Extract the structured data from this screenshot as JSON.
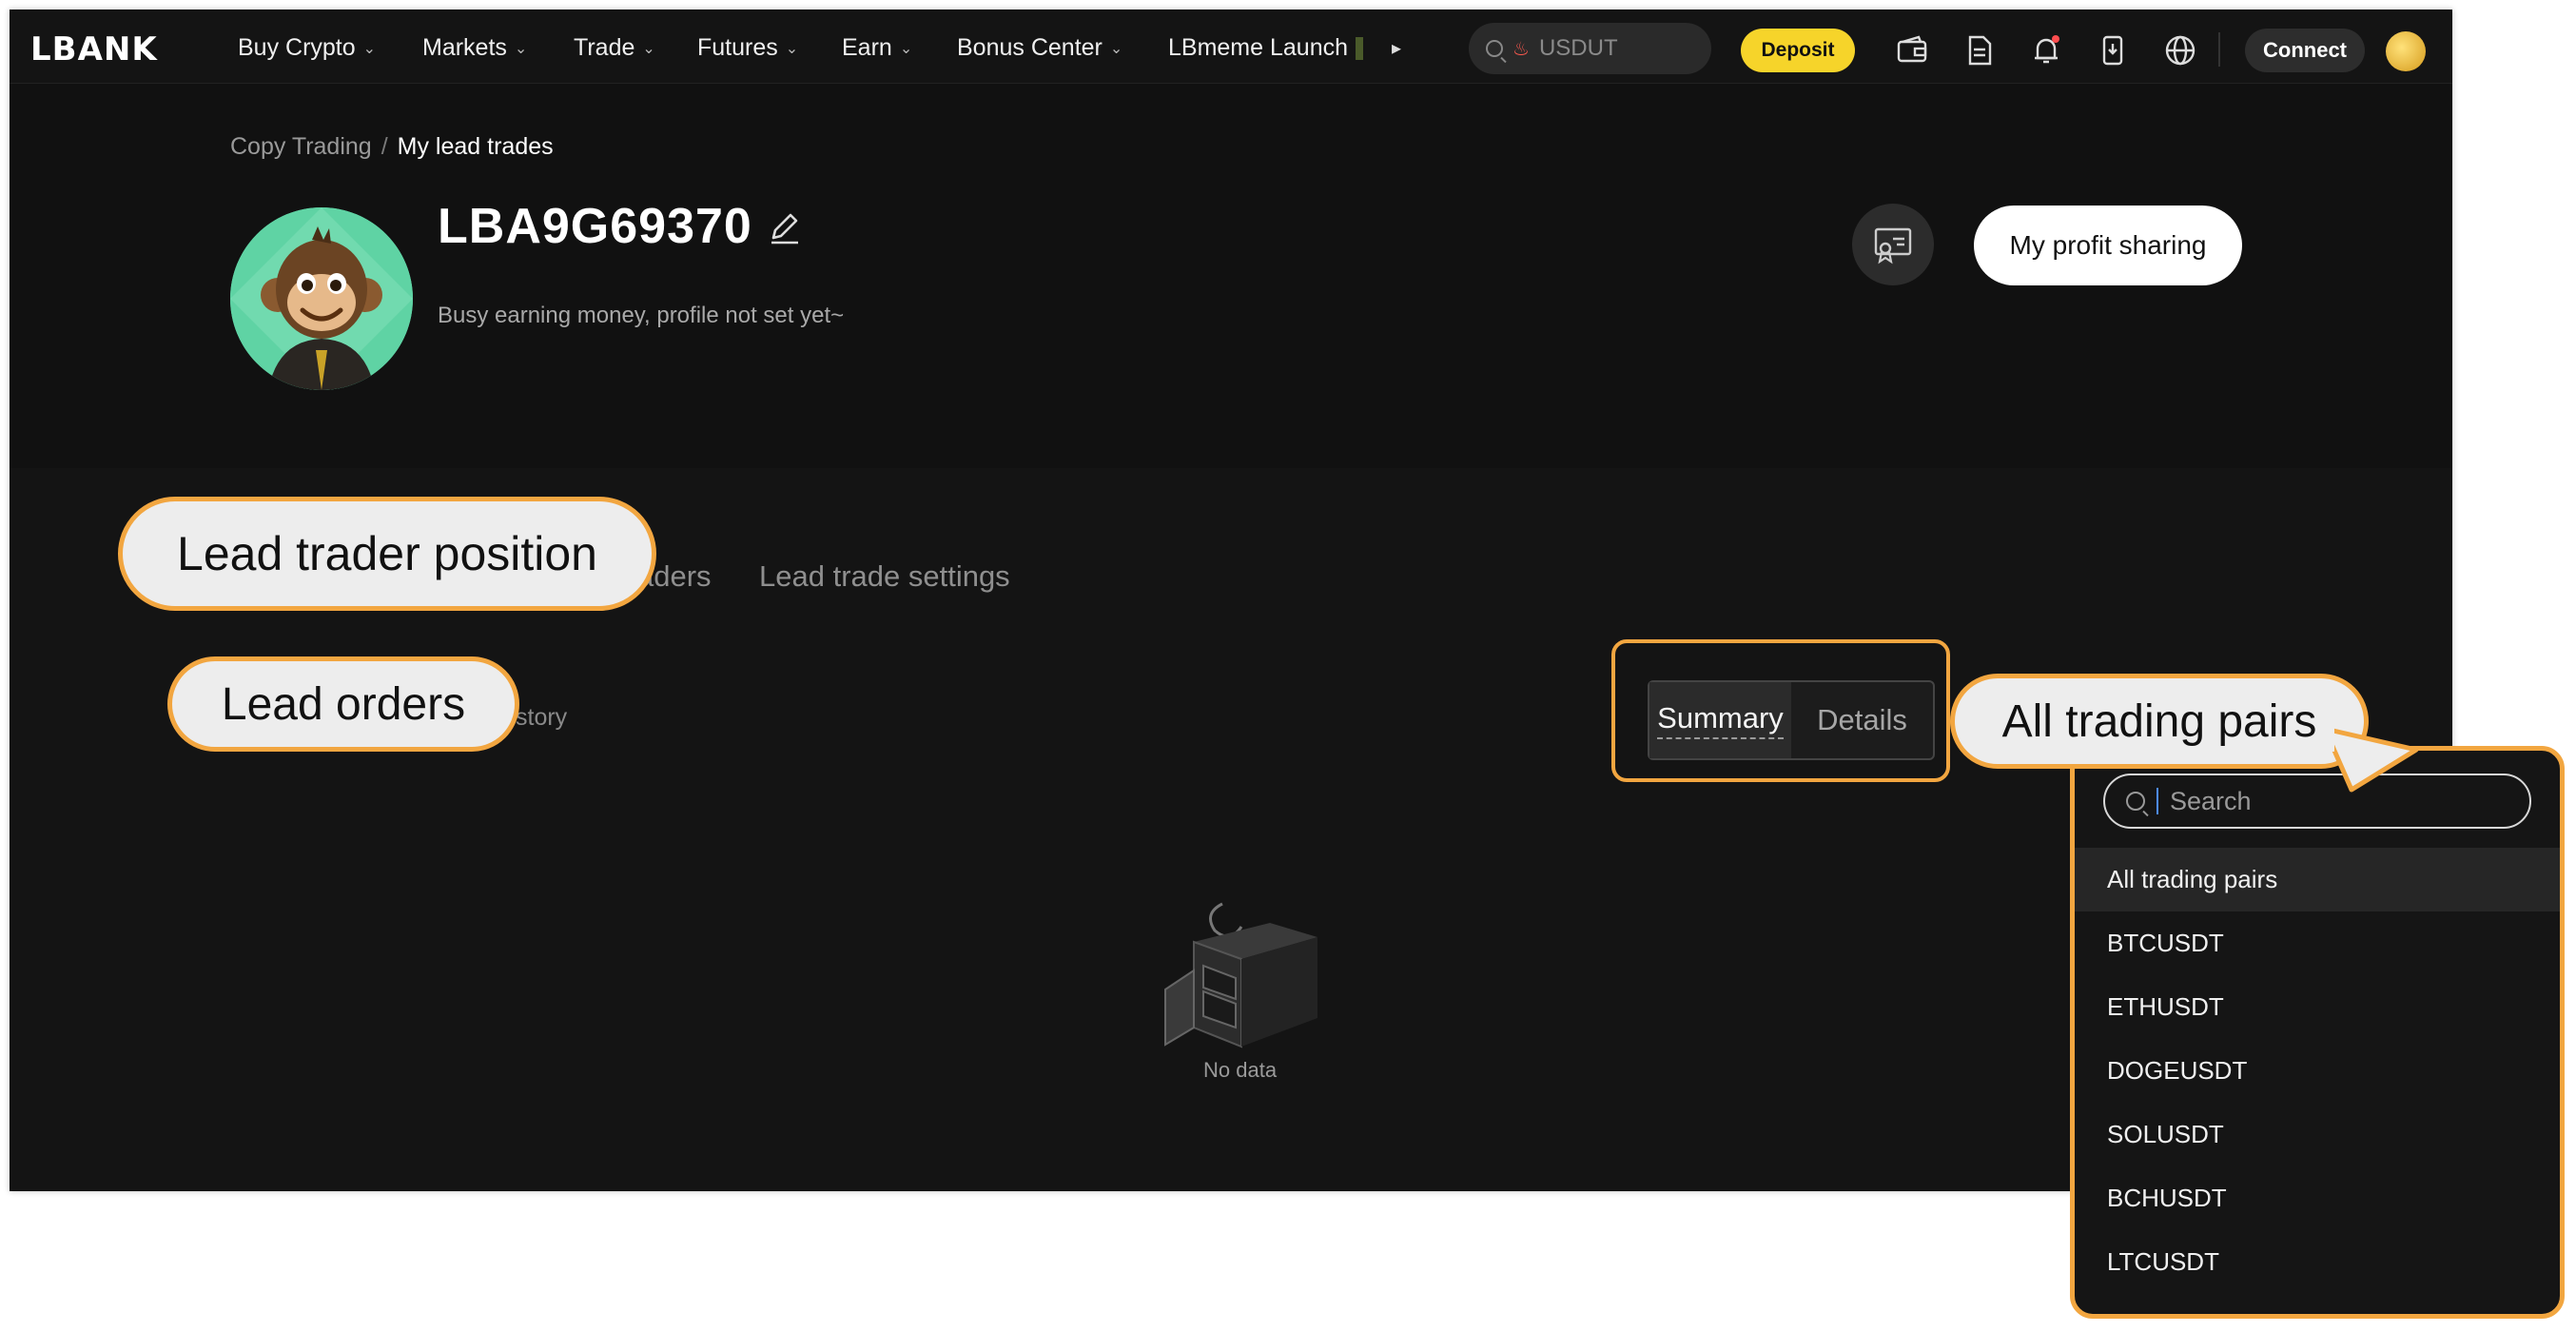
{
  "nav": {
    "logo": "LBANK",
    "items": [
      {
        "label": "Buy Crypto"
      },
      {
        "label": "Markets"
      },
      {
        "label": "Trade"
      },
      {
        "label": "Futures"
      },
      {
        "label": "Earn"
      },
      {
        "label": "Bonus Center"
      },
      {
        "label": "LBmeme Launch"
      }
    ],
    "search_text": "USDUT",
    "deposit_label": "Deposit",
    "connect_label": "Connect",
    "icons": [
      "wallet-icon",
      "orders-icon",
      "notification-bell-icon",
      "download-app-icon",
      "globe-icon"
    ],
    "accent_color": "#f6d42a"
  },
  "breadcrumb": {
    "parent": "Copy Trading",
    "separator": "/",
    "current": "My lead trades"
  },
  "profile": {
    "username": "LBA9G69370",
    "bio": "Busy earning money, profile not set yet~",
    "profit_sharing_label": "My profit sharing"
  },
  "tabs": {
    "copy_traders_partial": "aders",
    "settings": "Lead trade settings"
  },
  "subtabs": {
    "history_partial": "story"
  },
  "view_toggle": {
    "summary": "Summary",
    "details": "Details"
  },
  "empty_state": {
    "text": "No data"
  },
  "callouts": {
    "lead_trader_position": "Lead trader position",
    "lead_orders": "Lead orders",
    "all_trading_pairs": "All trading pairs",
    "border_color": "#f2a640"
  },
  "pair_dropdown": {
    "search_placeholder": "Search",
    "selected": "All trading pairs",
    "options": [
      "All trading pairs",
      "BTCUSDT",
      "ETHUSDT",
      "DOGEUSDT",
      "SOLUSDT",
      "BCHUSDT",
      "LTCUSDT"
    ]
  }
}
